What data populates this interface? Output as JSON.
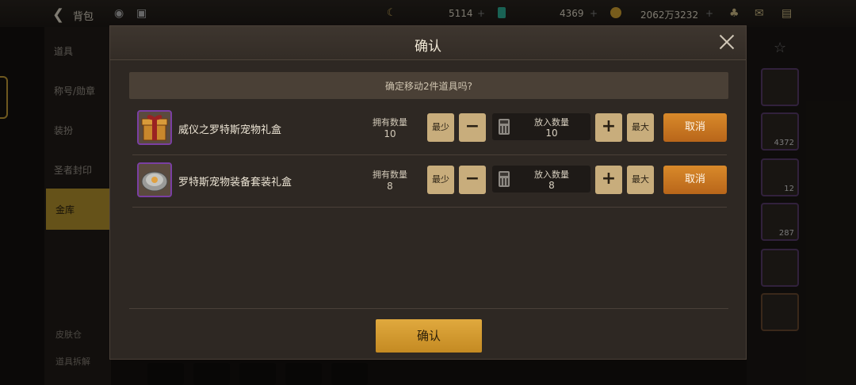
{
  "background": {
    "bag_title": "背包",
    "currencies": [
      {
        "value": "5114",
        "icon": "crescent-coin-icon"
      },
      {
        "value": "4369",
        "icon": "green-gem-icon"
      },
      {
        "value": "2062万3232",
        "icon": "gold-coin-icon"
      }
    ],
    "sidebar": [
      "道具",
      "称号/勋章",
      "装扮",
      "圣者封印",
      "金库"
    ],
    "bottom_buttons": [
      "皮肤仓",
      "道具拆解"
    ],
    "slot_counts": [
      "4372",
      "12",
      "287"
    ]
  },
  "modal": {
    "title": "确认",
    "question": "确定移动2件道具吗?",
    "confirm_label": "确认",
    "owned_label": "拥有数量",
    "put_label": "放入数量",
    "min_label": "最少",
    "max_label": "最大",
    "minus_symbol": "−",
    "plus_symbol": "+",
    "cancel_label": "取消",
    "items": [
      {
        "name": "威仪之罗特斯宠物礼盒",
        "owned": "10",
        "put": "10",
        "icon": "gift-box-icon"
      },
      {
        "name": "罗特斯宠物装备套装礼盒",
        "owned": "8",
        "put": "8",
        "icon": "pet-equipment-box-icon"
      }
    ]
  }
}
